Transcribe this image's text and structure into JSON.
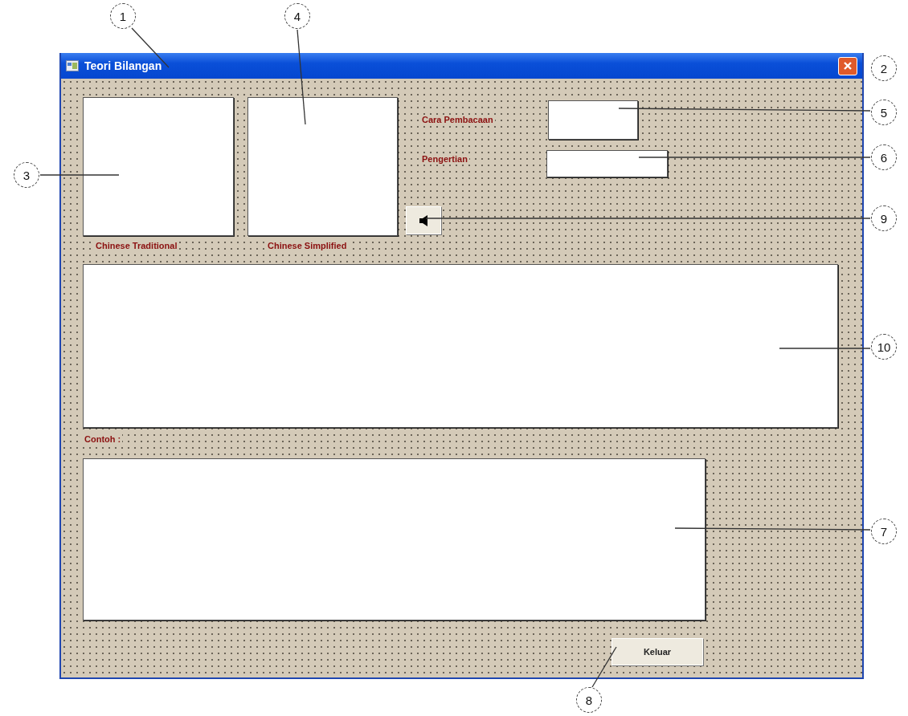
{
  "window": {
    "title": "Teori Bilangan"
  },
  "picture_boxes": [
    {
      "caption": "Chinese Traditional"
    },
    {
      "caption": "Chinese Simplified"
    }
  ],
  "fields": [
    {
      "label": "Cara Pembacaan"
    },
    {
      "label": "Pengertian"
    }
  ],
  "example": {
    "label": "Contoh :"
  },
  "buttons": [
    {
      "label": "Keluar"
    }
  ],
  "callouts": [
    {
      "number": "1"
    },
    {
      "number": "4"
    },
    {
      "number": "2"
    },
    {
      "number": "5"
    },
    {
      "number": "3"
    },
    {
      "number": "6"
    },
    {
      "number": "9"
    },
    {
      "number": "10"
    },
    {
      "number": "7"
    },
    {
      "number": "8"
    }
  ]
}
